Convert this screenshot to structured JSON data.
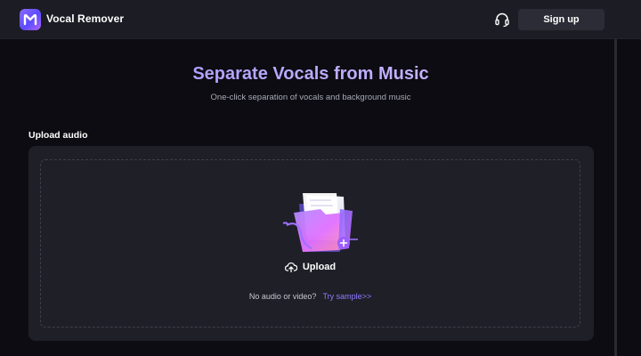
{
  "header": {
    "app_title": "Vocal Remover",
    "logo_letter": "M",
    "support_icon": "headset-icon",
    "signup_label": "Sign up"
  },
  "hero": {
    "title": "Separate Vocals from Music",
    "subtitle": "One-click separation of vocals and background music"
  },
  "upload": {
    "section_label": "Upload audio",
    "button_label": "Upload",
    "button_icon": "cloud-upload-icon",
    "no_audio_text": "No audio or video?",
    "try_sample_link": "Try sample>>"
  },
  "colors": {
    "background": "#0c0c12",
    "topbar": "#1c1c24",
    "card": "#1f1f28",
    "accent": "#8f7dff",
    "title_gradient_start": "#9c8cff",
    "title_gradient_end": "#d4c0ff"
  }
}
